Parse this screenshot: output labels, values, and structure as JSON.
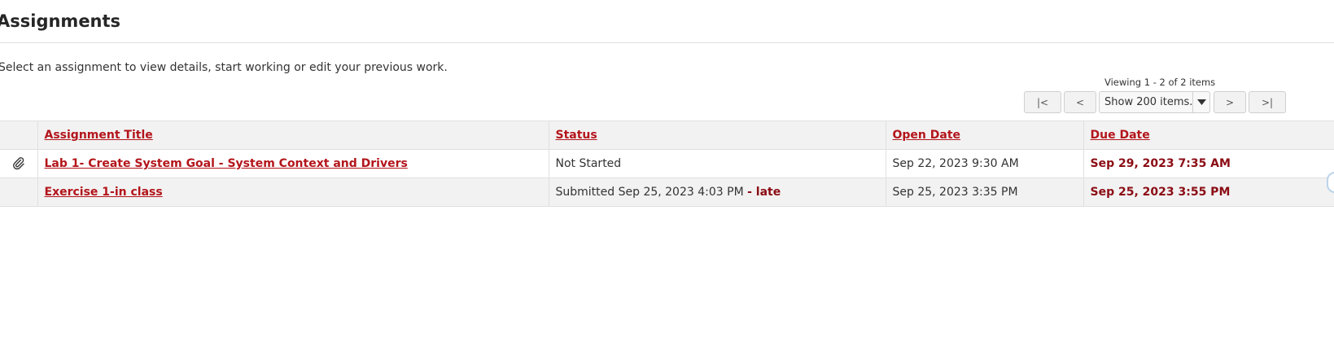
{
  "page": {
    "title": "Assignments",
    "instructions": "Select an assignment to view details, start working or edit your previous work."
  },
  "pager": {
    "viewing_text": "Viewing 1 - 2 of 2 items",
    "first_label": "|<",
    "prev_label": "<",
    "page_size_selected": "Show 200 items...",
    "next_label": ">",
    "last_label": ">|"
  },
  "table": {
    "headers": {
      "title": "Assignment Title",
      "status": "Status",
      "open_date": "Open Date",
      "due_date": "Due Date"
    },
    "rows": [
      {
        "has_attachment": true,
        "attachment_icon": "paperclip-icon",
        "title": "Lab 1- Create System Goal - System Context and Drivers",
        "status": "Not Started",
        "status_late": "",
        "open_date": "Sep 22, 2023 9:30 AM",
        "due_date": "Sep 29, 2023 7:35 AM"
      },
      {
        "has_attachment": false,
        "title": "Exercise 1-in class",
        "status": "Submitted Sep 25, 2023 4:03 PM",
        "status_late": "- late",
        "open_date": "Sep 25, 2023 3:35 PM",
        "due_date": "Sep 25, 2023 3:55 PM"
      }
    ]
  },
  "colors": {
    "link": "#b3151b",
    "due": "#8b0c14",
    "header_bg": "#f2f2f2"
  }
}
